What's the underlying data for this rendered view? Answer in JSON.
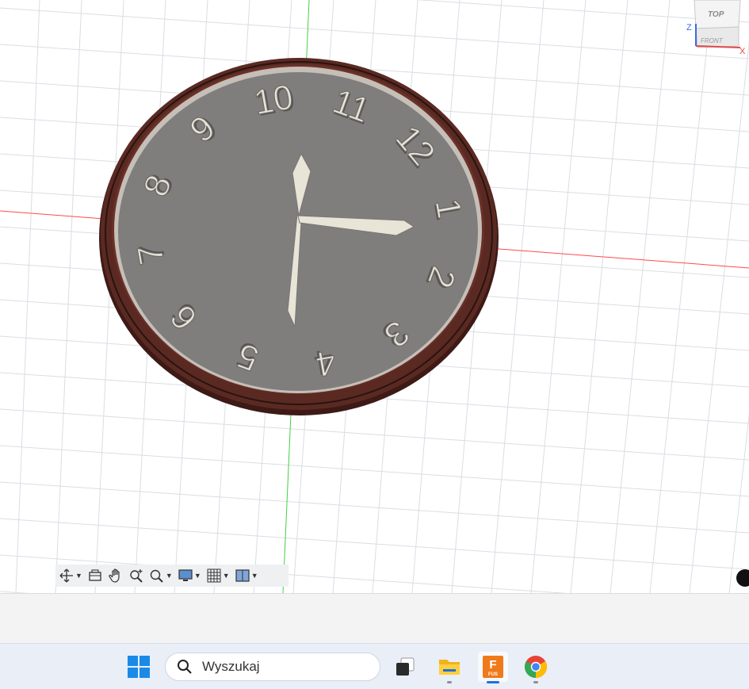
{
  "viewport": {
    "clock": {
      "numerals": [
        "10",
        "11",
        "12",
        "1",
        "2",
        "3",
        "4",
        "5",
        "6",
        "7",
        "8",
        "9"
      ],
      "colors": {
        "rim": "#5a2a22",
        "face": "#7f7e7c",
        "numeral": "#e6e3da",
        "hands": "#e8e4d6"
      }
    },
    "axes": {
      "x_axis_color": "#ff3a3a",
      "y_axis_color": "#3ad13a",
      "grid_color": "#d9dde3"
    },
    "viewcube": {
      "top_label": "TOP",
      "front_label": "FRONT",
      "z_label": "Z",
      "x_label": "X"
    }
  },
  "navbar": {
    "tools": [
      {
        "icon": "orbit-icon",
        "dropdown": true
      },
      {
        "icon": "look-at-icon",
        "dropdown": false
      },
      {
        "icon": "pan-hand-icon",
        "dropdown": false
      },
      {
        "icon": "zoom-icon",
        "dropdown": false
      },
      {
        "icon": "zoom-window-icon",
        "dropdown": true
      },
      {
        "icon": "display-settings-icon",
        "dropdown": true
      },
      {
        "icon": "grid-settings-icon",
        "dropdown": true
      },
      {
        "icon": "viewports-icon",
        "dropdown": true
      }
    ]
  },
  "taskbar": {
    "search_placeholder": "Wyszukaj",
    "apps": [
      {
        "icon": "windows-start-icon"
      },
      {
        "icon": "task-view-icon"
      },
      {
        "icon": "file-explorer-icon"
      },
      {
        "icon": "fusion-app-icon",
        "label": "FUS",
        "letter": "F",
        "active": true
      },
      {
        "icon": "chrome-icon"
      }
    ]
  }
}
